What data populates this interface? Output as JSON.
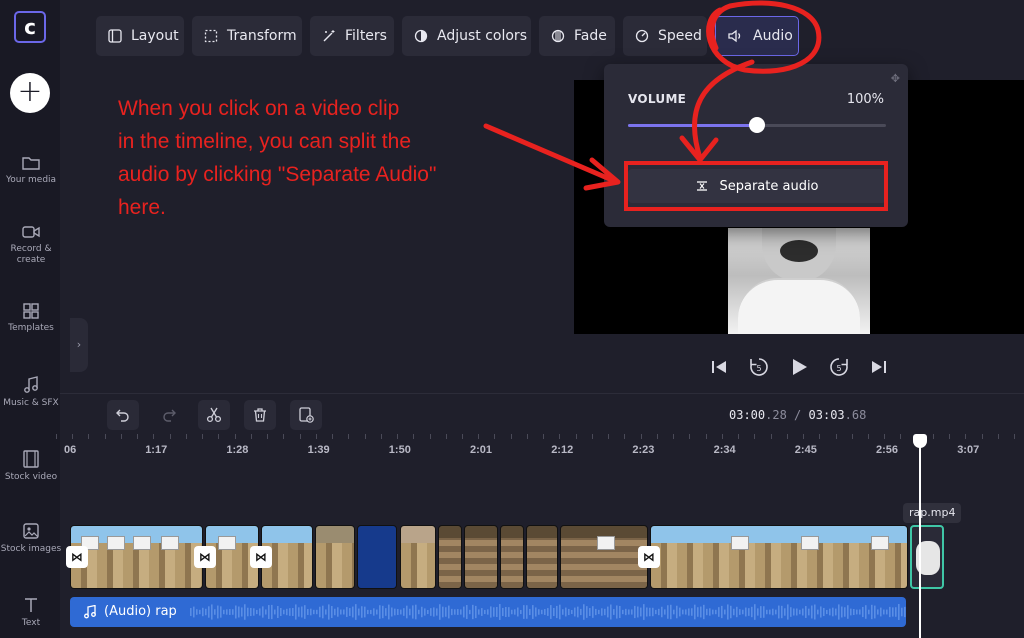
{
  "toolbar": {
    "buttons": [
      {
        "label": "Layout",
        "icon": "layout-icon"
      },
      {
        "label": "Transform",
        "icon": "transform-icon"
      },
      {
        "label": "Filters",
        "icon": "filters-icon"
      },
      {
        "label": "Adjust colors",
        "icon": "adjust-colors-icon"
      },
      {
        "label": "Fade",
        "icon": "fade-icon"
      },
      {
        "label": "Speed",
        "icon": "speed-icon"
      },
      {
        "label": "Audio",
        "icon": "audio-icon",
        "active": true
      }
    ]
  },
  "sidebar": {
    "items": [
      {
        "label": "Your media",
        "icon": "folder-icon"
      },
      {
        "label": "Record & create",
        "icon": "camera-icon"
      },
      {
        "label": "Templates",
        "icon": "templates-icon"
      },
      {
        "label": "Music & SFX",
        "icon": "music-icon"
      },
      {
        "label": "Stock video",
        "icon": "film-icon"
      },
      {
        "label": "Stock images",
        "icon": "image-icon"
      },
      {
        "label": "Text",
        "icon": "text-icon"
      }
    ]
  },
  "audio_panel": {
    "title": "VOLUME",
    "value_label": "100%",
    "volume_level": 0.5,
    "separate_label": "Separate audio"
  },
  "annotation": {
    "text": "When you click on a video clip\nin the timeline, you can split the\naudio by clicking \"Separate Audio\"\nhere.",
    "color": "#e8221f"
  },
  "timeline": {
    "current_time_main": "03:00",
    "current_time_frac": ".28",
    "separator": "/",
    "total_time_main": "03:03",
    "total_time_frac": ".68",
    "ruler_labels": [
      "06",
      "1:17",
      "1:28",
      "1:39",
      "1:50",
      "2:01",
      "2:12",
      "2:23",
      "2:34",
      "2:45",
      "2:56",
      "3:07"
    ],
    "video_clip_name": "rap.mp4",
    "audio_clip_label": "(Audio) rap"
  },
  "colors": {
    "accent": "#7c74ee",
    "audio_track": "#2f6ad4",
    "selected_clip_border": "#3fc6a6"
  }
}
